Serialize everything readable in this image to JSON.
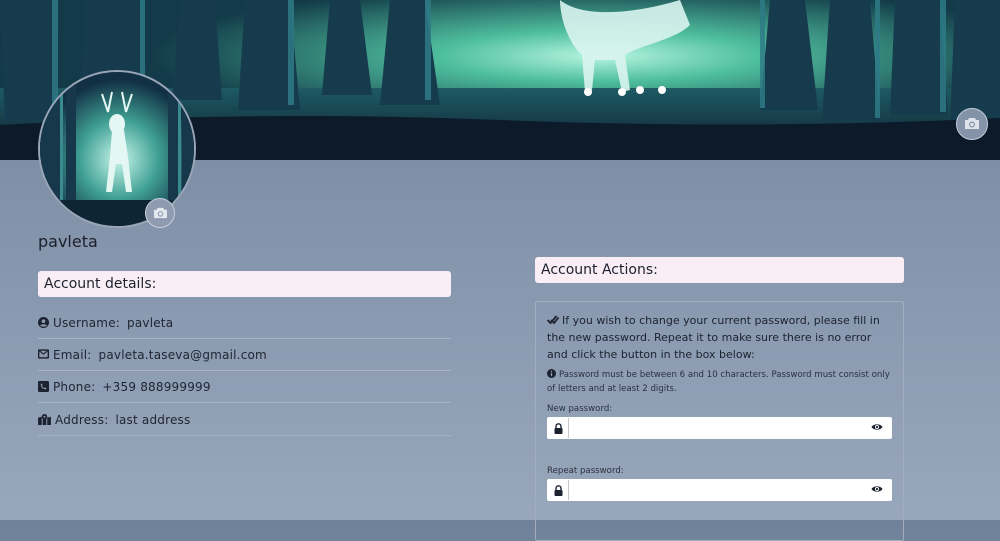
{
  "profile": {
    "username": "pavleta"
  },
  "account_details": {
    "heading": "Account details:",
    "rows": [
      {
        "icon": "user-circle-icon",
        "label": "Username:",
        "value": "pavleta"
      },
      {
        "icon": "envelope-icon",
        "label": "Email:",
        "value": "pavleta.taseva@gmail.com"
      },
      {
        "icon": "phone-icon",
        "label": "Phone:",
        "value": "+359 888999999"
      },
      {
        "icon": "map-location-icon",
        "label": "Address:",
        "value": "last address"
      }
    ]
  },
  "account_actions": {
    "heading": "Account Actions:",
    "intro": "If you wish to change your current password, please fill in the new password. Repeat it to make sure there is no error and click the button in the box below:",
    "note": "Password must be between 6 and 10 characters. Password must consist only of letters and at least 2 digits.",
    "new_password_label": "New password:",
    "repeat_password_label": "Repeat password:",
    "new_password_value": "",
    "repeat_password_value": ""
  },
  "colors": {
    "header_bg": "#f8eef4",
    "page_bg_top": "#6f829a",
    "page_bg_bottom": "#98a7bb"
  },
  "icons": [
    "camera-icon",
    "double-check-icon",
    "info-circle-icon",
    "lock-icon",
    "eye-icon"
  ]
}
